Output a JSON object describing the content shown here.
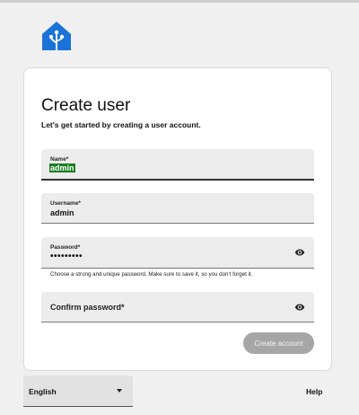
{
  "card": {
    "title": "Create user",
    "subtitle": "Let's get started by creating a user account."
  },
  "fields": {
    "name": {
      "label": "Name*",
      "value": "admin"
    },
    "username": {
      "label": "Username*",
      "value": "admin"
    },
    "password": {
      "label": "Password*",
      "value": "•••••••••",
      "helper": "Choose a strong and unique password. Make sure to save it, so you don't forget it."
    },
    "confirm": {
      "placeholder": "Confirm password*"
    }
  },
  "actions": {
    "create_label": "Create account"
  },
  "footer": {
    "language": "English",
    "help": "Help"
  },
  "icons": {
    "logo": "home-assistant-logo-icon",
    "show_password": "eye-icon",
    "dropdown": "caret-down-icon"
  },
  "colors": {
    "brand": "#18bcf2",
    "selection": "#1a7f22",
    "button_disabled": "#a6a6a6"
  }
}
